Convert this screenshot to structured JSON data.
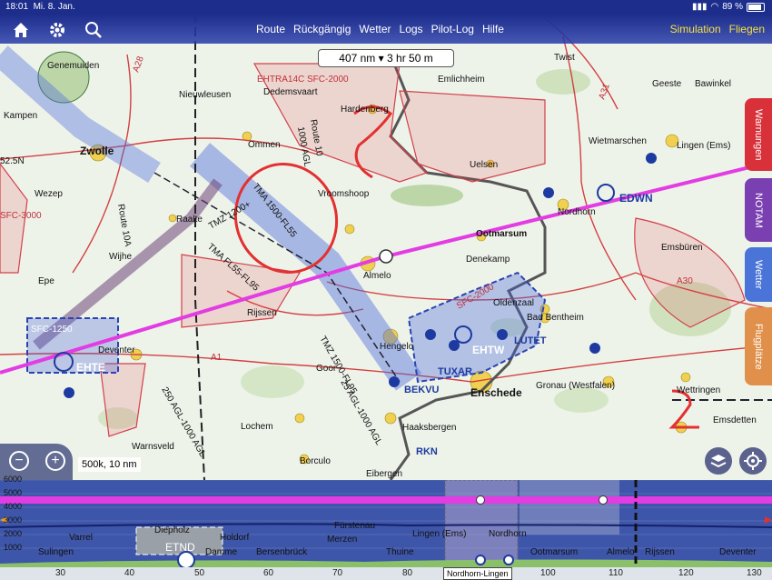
{
  "status": {
    "time": "18:01",
    "date": "Mi. 8. Jan.",
    "battery": "89 %"
  },
  "nav": {
    "menu": [
      "Route",
      "Rückgängig",
      "Wetter",
      "Logs",
      "Pilot-Log",
      "Hilfe"
    ],
    "right": [
      "Simulation",
      "Fliegen"
    ]
  },
  "route_info": {
    "distance": "407 nm",
    "time": "3 hr 50 m"
  },
  "side_tabs": [
    "Warnungen",
    "NOTAM",
    "Wetter",
    "Flugplätze"
  ],
  "scale": "500k, 10 nm",
  "colors": {
    "nav": "#1d2d8c",
    "route": "#e23ce2",
    "accent": "#f5e23a",
    "warn": "#d8313a",
    "notam": "#7a3fb0",
    "wetter": "#4a74d8",
    "fluplatz": "#e0904a"
  },
  "map_labels": {
    "towns": [
      "Genemuiden",
      "Nieuwleusen",
      "Dedemsvaart",
      "Hardenberg",
      "Emlichheim",
      "Twist",
      "Geeste",
      "Bawinkel",
      "Kampen",
      "Zwolle",
      "Ommen",
      "Wietmarschen",
      "Lingen (Ems)",
      "Uelsen",
      "Wezep",
      "Vroomshoop",
      "Nordhorn",
      "Raalte",
      "Ootmarsum",
      "Denekamp",
      "Emsbüren",
      "Wijhe",
      "Epe",
      "Almelo",
      "Oldenzaal",
      "Rijssen",
      "Bad Bentheim",
      "Deventer",
      "Hengelo",
      "Gronau (Westfalen)",
      "Goor",
      "Enschede",
      "Wettringen",
      "Lochem",
      "Haaksbergen",
      "Emsdetten",
      "Warnsveld",
      "Borculo",
      "Eibergen"
    ],
    "airspace": [
      "EHTRA14C SFC-2000",
      "EDWN",
      "EHTW",
      "LUTET",
      "TUXAR",
      "BEKVU",
      "RKN",
      "EHTE",
      "SFC-1250",
      "SFC-3000",
      "TMZ 1200+",
      "TMZ 1500-FL95",
      "TMA FL55-FL95",
      "TMA 1500-FL55",
      "250 AGL-1000 AGL",
      "25 AGL-1000 AGL",
      "Route 10",
      "Route 10A",
      "1000 AGL",
      "SFC-2000",
      "52.5N",
      "A28",
      "A31",
      "A1",
      "A30"
    ]
  },
  "profile": {
    "alt_labels": [
      "6000",
      "5000",
      "4000",
      "3000",
      "2000",
      "1000"
    ],
    "labels_upper": [
      "Varrel",
      "Diepholz",
      "Holdorf",
      "Fürstenau",
      "Lingen (Ems)",
      "Nordhorn"
    ],
    "labels_lower": [
      "Sulingen",
      "ETND",
      "Damme",
      "Bersenbrück",
      "Merzen",
      "Thuine",
      "Ootmarsum",
      "Almelo",
      "Rijssen",
      "Deventer"
    ],
    "axis": [
      "30",
      "40",
      "50",
      "60",
      "70",
      "80",
      "90",
      "100",
      "110",
      "120",
      "130"
    ],
    "route_name": "Nordhorn-Lingen"
  }
}
